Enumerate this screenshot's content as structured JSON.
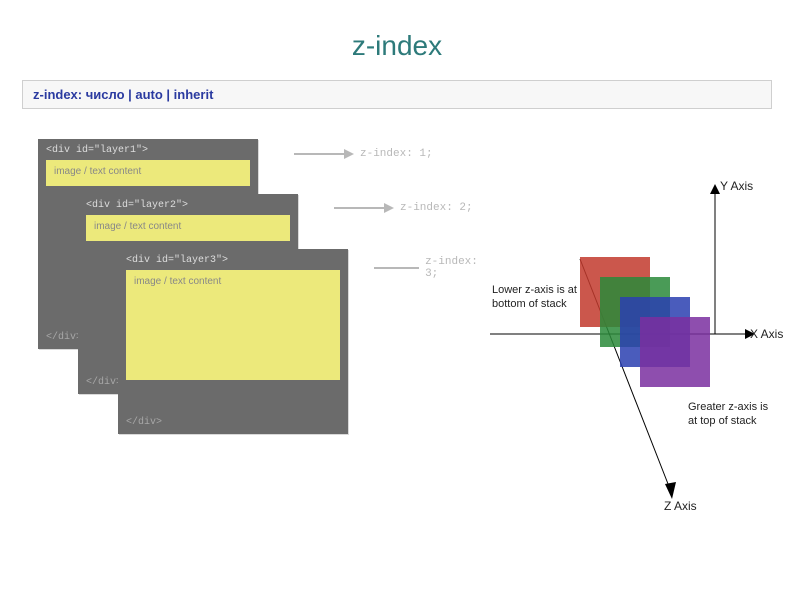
{
  "title": "z-index",
  "syntax": "z-index: число | auto | inherit",
  "layers": {
    "card1": {
      "open": "<div id=\"layer1\">",
      "content": "image / text content",
      "close": "</div>"
    },
    "card2": {
      "open": "<div id=\"layer2\">",
      "content": "image / text content",
      "close": "</div>"
    },
    "card3": {
      "open": "<div id=\"layer3\">",
      "content": "image / text content",
      "close": "</div>"
    }
  },
  "arrows": {
    "a1": "z-index: 1;",
    "a2": "z-index: 2;",
    "a3": "z-index: 3;"
  },
  "axis": {
    "y": "Y Axis",
    "x": "X Axis",
    "z": "Z Axis",
    "note_top": "Lower z-axis is at bottom of stack",
    "note_bot": "Greater z-axis is at top of stack"
  }
}
